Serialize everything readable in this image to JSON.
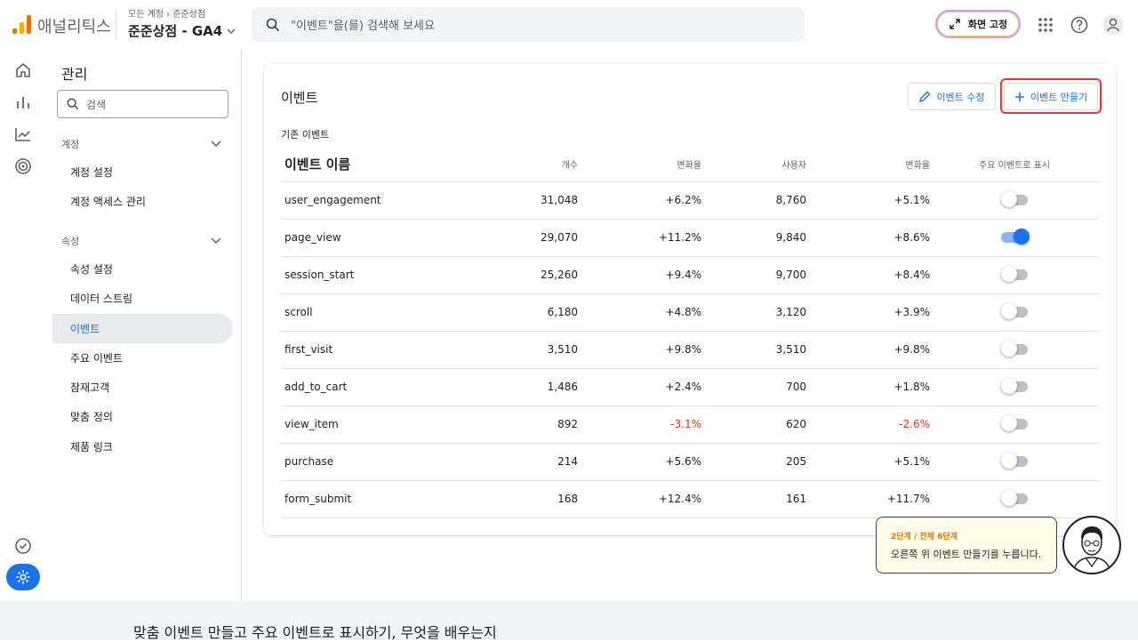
{
  "header": {
    "brand": "애널리틱스",
    "breadcrumb_root": "모든 계정",
    "breadcrumb_sep": "›",
    "breadcrumb_account": "준준상점",
    "property": "준준상점 - GA4",
    "search_placeholder": "\"이벤트\"을(를) 검색해 보세요",
    "pin_label": "화면 고정"
  },
  "sidebar": {
    "title": "관리",
    "search_placeholder": "검색",
    "section_account": "계정",
    "account_items": [
      "계정 설정",
      "계정 액세스 관리"
    ],
    "section_property": "속성",
    "property_items": [
      "속성 설정",
      "데이터 스트림",
      "이벤트",
      "주요 이벤트",
      "잠재고객",
      "맞춤 정의",
      "제품 링크"
    ],
    "active_item": "이벤트"
  },
  "card": {
    "title": "이벤트",
    "edit_label": "이벤트 수정",
    "create_label": "이벤트 만들기",
    "subtitle": "기존 이벤트",
    "columns": [
      "이벤트 이름",
      "개수",
      "변화율",
      "사용자",
      "변화율",
      "주요 이벤트로 표시"
    ],
    "rows": [
      {
        "name": "user_engagement",
        "count": "31,048",
        "change": "+6.2%",
        "users": "8,760",
        "user_change": "+5.1%",
        "key": false
      },
      {
        "name": "page_view",
        "count": "29,070",
        "change": "+11.2%",
        "users": "9,840",
        "user_change": "+8.6%",
        "key": true
      },
      {
        "name": "session_start",
        "count": "25,260",
        "change": "+9.4%",
        "users": "9,700",
        "user_change": "+8.4%",
        "key": false
      },
      {
        "name": "scroll",
        "count": "6,180",
        "change": "+4.8%",
        "users": "3,120",
        "user_change": "+3.9%",
        "key": false
      },
      {
        "name": "first_visit",
        "count": "3,510",
        "change": "+9.8%",
        "users": "3,510",
        "user_change": "+9.8%",
        "key": false
      },
      {
        "name": "add_to_cart",
        "count": "1,486",
        "change": "+2.4%",
        "users": "700",
        "user_change": "+1.8%",
        "key": false
      },
      {
        "name": "view_item",
        "count": "892",
        "change": "-3.1%",
        "users": "620",
        "user_change": "-2.6%",
        "key": false
      },
      {
        "name": "purchase",
        "count": "214",
        "change": "+5.6%",
        "users": "205",
        "user_change": "+5.1%",
        "key": false
      },
      {
        "name": "form_submit",
        "count": "168",
        "change": "+12.4%",
        "users": "161",
        "user_change": "+11.7%",
        "key": false
      }
    ]
  },
  "tutorial": {
    "step": "2단계 / 전체 6단계",
    "message": "오른쪽 위 이벤트 만들기를 누릅니다."
  },
  "footer": {
    "caption": "맞춤 이벤트 만들고 주요 이벤트로 표시하기, 무엇을 배우는지"
  },
  "colors": {
    "accent": "#1a73e8",
    "negative": "#d93025",
    "highlight": "#e53935",
    "tip_bg": "#fffbe6"
  }
}
